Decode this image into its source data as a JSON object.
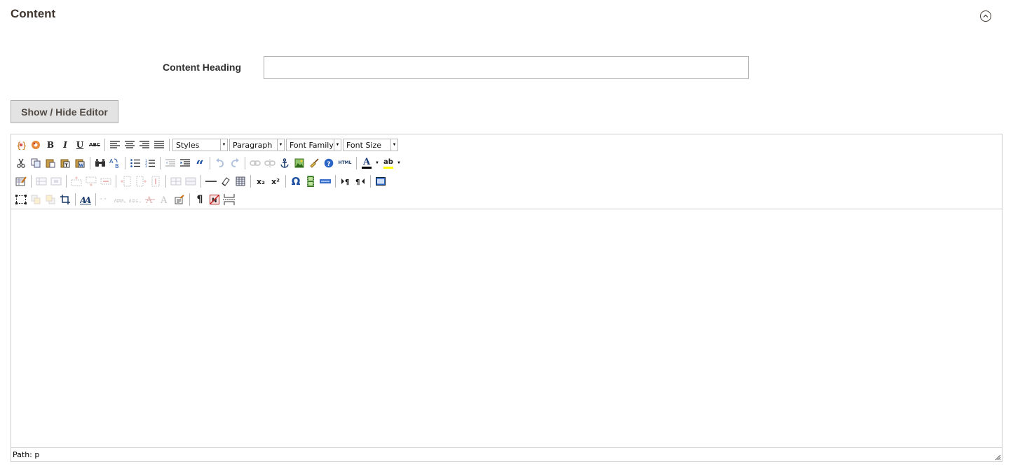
{
  "section": {
    "title": "Content"
  },
  "form": {
    "heading_label": "Content Heading",
    "heading_value": "",
    "toggle_editor_label": "Show / Hide Editor"
  },
  "editor": {
    "dropdowns": {
      "styles": "Styles",
      "format": "Paragraph",
      "font_family": "Font Family",
      "font_size": "Font Size"
    },
    "glyphs": {
      "bold": "B",
      "italic": "I",
      "underline": "U",
      "strikethrough": "ABC",
      "blockquote": "“",
      "html": "HTML",
      "omega": "Ω",
      "subscript": "x₂",
      "superscript": "x²",
      "pilcrow": "¶",
      "forecolor": "A",
      "backcolor": "ab"
    },
    "colors": {
      "forecolor_bar": "#000000",
      "backcolor_bar": "#ffff00"
    },
    "status_path": "Path: p"
  }
}
